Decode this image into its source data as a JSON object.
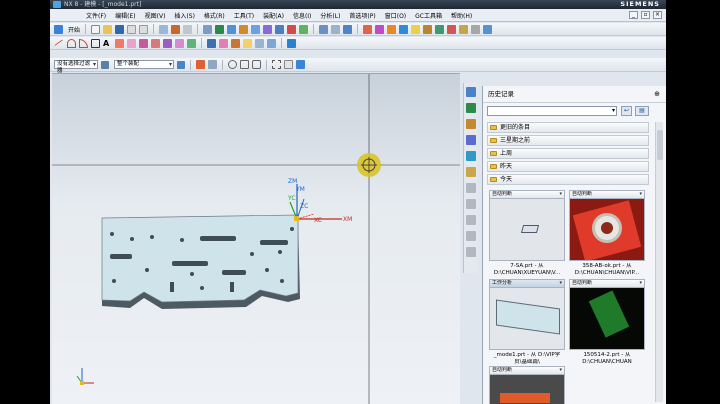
{
  "window": {
    "title": "NX 8 - 建模 - [_mode1.prt]",
    "brand": "SIEMENS"
  },
  "menu": {
    "items": [
      "文件(F)",
      "编辑(E)",
      "视图(V)",
      "插入(S)",
      "格式(R)",
      "工具(T)",
      "装配(A)",
      "信息(I)",
      "分析(L)",
      "首选项(P)",
      "窗口(O)",
      "GC工具箱",
      "帮助(H)"
    ]
  },
  "toolbar": {
    "start_label": "开始",
    "filter_select": "没有选择过滤器",
    "assembly_select": "整个装配"
  },
  "history": {
    "title": "历史记录",
    "groups": [
      "更旧的条目",
      "三星期之前",
      "上周",
      "昨天",
      "今天"
    ],
    "cards": [
      {
        "tab": "自动判断",
        "caption1": "7-SA.prt - 从",
        "caption2": "D:\\CHUAN\\XUEYUAN\\V..."
      },
      {
        "tab": "自动判断",
        "caption1": "358-AB-ok.prt - 从",
        "caption2": "D:\\CHUAN\\CHUAN\\VIP..."
      },
      {
        "tab": "工作分析",
        "caption1": "_mode1.prt - 从 D:\\VIP学",
        "caption2": "员\\基础篇\\"
      },
      {
        "tab": "自动判断",
        "caption1": "150514-2.prt - 从",
        "caption2": "D:\\CHUAN\\CHUAN"
      },
      {
        "tab": "自动判断",
        "caption1": "",
        "caption2": ""
      }
    ]
  },
  "axes": {
    "zm": "ZM",
    "ym": "YM",
    "xm": "XM",
    "zc": "ZC",
    "yc": "YC",
    "xc": "XC"
  },
  "colors": {
    "accent": "#1e66c8",
    "part": "#cfe3ea",
    "part_dark": "#5d6b74"
  }
}
